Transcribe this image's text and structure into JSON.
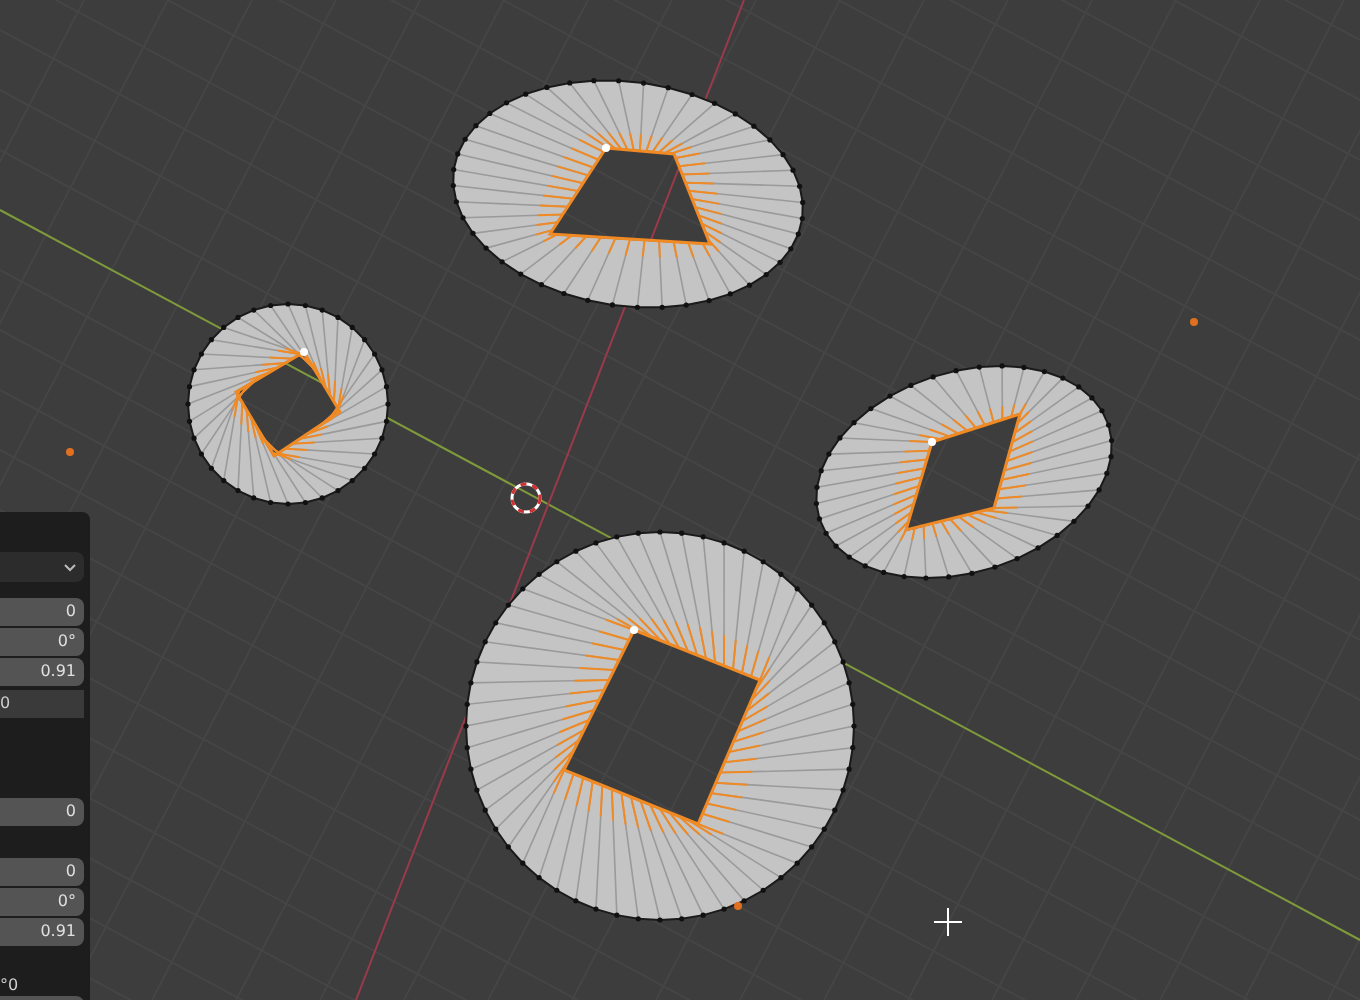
{
  "panel": {
    "groups": [
      {
        "rows": [
          {
            "kind": "dropdown"
          },
          {
            "kind": "number",
            "value": "0"
          },
          {
            "kind": "number",
            "value": "0°"
          },
          {
            "kind": "number",
            "value": "0.91"
          },
          {
            "kind": "readout",
            "value": "0"
          }
        ]
      },
      {
        "rows": [
          {
            "kind": "number",
            "value": "0"
          }
        ]
      },
      {
        "rows": [
          {
            "kind": "number",
            "value": "0"
          },
          {
            "kind": "number",
            "value": "0°"
          },
          {
            "kind": "number",
            "value": "0.91"
          },
          {
            "kind": "label",
            "value": "°0"
          },
          {
            "kind": "field"
          }
        ]
      }
    ]
  }
}
